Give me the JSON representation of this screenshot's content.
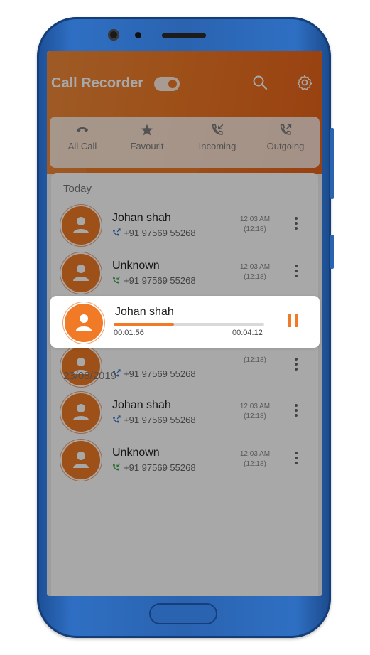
{
  "header": {
    "title": "Call Recorder",
    "toggle_on": true
  },
  "tabs": [
    {
      "label": "All Call",
      "icon": "phone-icon"
    },
    {
      "label": "Favourit",
      "icon": "star-icon"
    },
    {
      "label": "Incoming",
      "icon": "incoming-call-icon"
    },
    {
      "label": "Outgoing",
      "icon": "outgoing-call-icon"
    }
  ],
  "sections": [
    {
      "label": "Today",
      "calls": [
        {
          "name": "Johan shah",
          "number": "+91 97569 55268",
          "time": "12:03 AM",
          "duration": "(12:18)",
          "type": "outgoing"
        },
        {
          "name": "Unknown",
          "number": "+91 97569 55268",
          "time": "12:03 AM",
          "duration": "(12:18)",
          "type": "incoming"
        },
        {
          "name": "",
          "number": "+91 97569 55268",
          "time": "",
          "duration": "(12:18)",
          "type": "outgoing"
        }
      ]
    },
    {
      "label": "23/08/2019",
      "calls": [
        {
          "name": "Johan shah",
          "number": "+91 97569 55268",
          "time": "12:03 AM",
          "duration": "(12:18)",
          "type": "outgoing"
        },
        {
          "name": "Unknown",
          "number": "+91 97569 55268",
          "time": "12:03 AM",
          "duration": "(12:18)",
          "type": "incoming"
        }
      ]
    }
  ],
  "player": {
    "name": "Johan shah",
    "current": "00:01:56",
    "total": "00:04:12",
    "progress_fraction": 0.4
  },
  "colors": {
    "accent": "#f07a26",
    "outgoing": "#3a72c8",
    "incoming": "#3aa14a"
  }
}
